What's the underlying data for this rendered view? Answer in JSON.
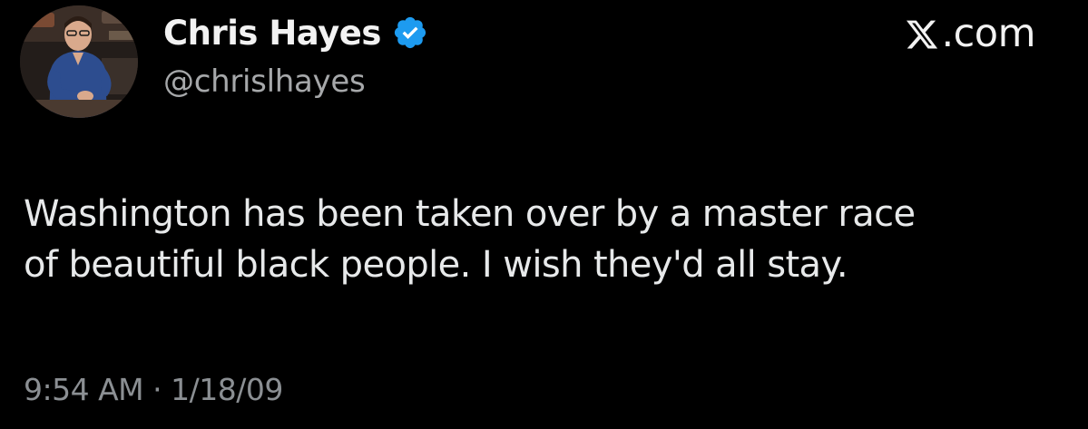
{
  "author": {
    "display_name": "Chris Hayes",
    "handle": "@chrislhayes",
    "verified_icon": "verified-badge-icon",
    "avatar_icon": "profile-photo"
  },
  "site": {
    "logo_icon": "x-logo-icon",
    "label_suffix": ".com"
  },
  "tweet": {
    "lines": [
      "Washington has been taken over by a master race",
      "of beautiful black people. I wish they'd all stay."
    ],
    "timestamp": "9:54 AM · 1/18/09"
  },
  "colors": {
    "background": "#000000",
    "primary_text": "#e7e9ea",
    "secondary_text": "#8b8f93",
    "verified_blue": "#1d9bf0"
  }
}
